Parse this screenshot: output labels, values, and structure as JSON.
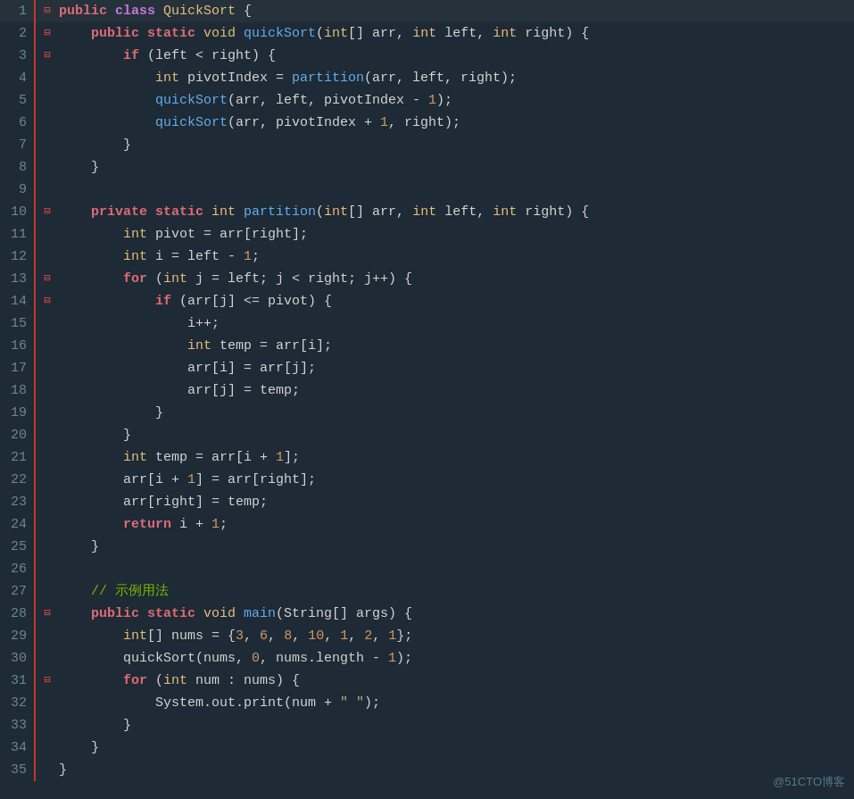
{
  "lines": [
    {
      "num": 1,
      "fold": "⊟",
      "tokens": [
        {
          "t": "public ",
          "c": "kw"
        },
        {
          "t": "class ",
          "c": "kw2"
        },
        {
          "t": "QuickSort",
          "c": "cls"
        },
        {
          "t": " {",
          "c": "punct"
        }
      ]
    },
    {
      "num": 2,
      "fold": "⊟",
      "tokens": [
        {
          "t": "    public ",
          "c": "kw"
        },
        {
          "t": "static ",
          "c": "kw"
        },
        {
          "t": "void ",
          "c": "type"
        },
        {
          "t": "quickSort",
          "c": "fn"
        },
        {
          "t": "(",
          "c": "punct"
        },
        {
          "t": "int",
          "c": "type"
        },
        {
          "t": "[] arr, ",
          "c": "var"
        },
        {
          "t": "int ",
          "c": "type"
        },
        {
          "t": "left, ",
          "c": "var"
        },
        {
          "t": "int ",
          "c": "type"
        },
        {
          "t": "right) {",
          "c": "var"
        }
      ]
    },
    {
      "num": 3,
      "fold": "⊟",
      "tokens": [
        {
          "t": "        ",
          "c": ""
        },
        {
          "t": "if ",
          "c": "kw"
        },
        {
          "t": "(left < right) {",
          "c": "var"
        }
      ]
    },
    {
      "num": 4,
      "fold": "",
      "tokens": [
        {
          "t": "            ",
          "c": ""
        },
        {
          "t": "int ",
          "c": "type"
        },
        {
          "t": "pivotIndex = ",
          "c": "var"
        },
        {
          "t": "partition",
          "c": "fn"
        },
        {
          "t": "(arr, left, right);",
          "c": "var"
        }
      ]
    },
    {
      "num": 5,
      "fold": "",
      "tokens": [
        {
          "t": "            ",
          "c": ""
        },
        {
          "t": "quickSort",
          "c": "fn"
        },
        {
          "t": "(arr, left, pivotIndex - ",
          "c": "var"
        },
        {
          "t": "1",
          "c": "num"
        },
        {
          "t": ");",
          "c": "punct"
        }
      ]
    },
    {
      "num": 6,
      "fold": "",
      "tokens": [
        {
          "t": "            ",
          "c": ""
        },
        {
          "t": "quickSort",
          "c": "fn"
        },
        {
          "t": "(arr, pivotIndex + ",
          "c": "var"
        },
        {
          "t": "1",
          "c": "num"
        },
        {
          "t": ", right);",
          "c": "punct"
        }
      ]
    },
    {
      "num": 7,
      "fold": "",
      "tokens": [
        {
          "t": "        }",
          "c": "punct"
        }
      ]
    },
    {
      "num": 8,
      "fold": "",
      "tokens": [
        {
          "t": "    }",
          "c": "punct"
        }
      ]
    },
    {
      "num": 9,
      "fold": "",
      "tokens": [
        {
          "t": "",
          "c": ""
        }
      ]
    },
    {
      "num": 10,
      "fold": "⊟",
      "tokens": [
        {
          "t": "    ",
          "c": ""
        },
        {
          "t": "private ",
          "c": "kw"
        },
        {
          "t": "static ",
          "c": "kw"
        },
        {
          "t": "int ",
          "c": "type"
        },
        {
          "t": "partition",
          "c": "fn"
        },
        {
          "t": "(",
          "c": "punct"
        },
        {
          "t": "int",
          "c": "type"
        },
        {
          "t": "[] arr, ",
          "c": "var"
        },
        {
          "t": "int ",
          "c": "type"
        },
        {
          "t": "left, ",
          "c": "var"
        },
        {
          "t": "int ",
          "c": "type"
        },
        {
          "t": "right) {",
          "c": "var"
        }
      ]
    },
    {
      "num": 11,
      "fold": "",
      "tokens": [
        {
          "t": "        ",
          "c": ""
        },
        {
          "t": "int ",
          "c": "type"
        },
        {
          "t": "pivot = arr[right];",
          "c": "var"
        }
      ]
    },
    {
      "num": 12,
      "fold": "",
      "tokens": [
        {
          "t": "        ",
          "c": ""
        },
        {
          "t": "int ",
          "c": "type"
        },
        {
          "t": "i = left - ",
          "c": "var"
        },
        {
          "t": "1",
          "c": "num"
        },
        {
          "t": ";",
          "c": "punct"
        }
      ]
    },
    {
      "num": 13,
      "fold": "⊟",
      "tokens": [
        {
          "t": "        ",
          "c": ""
        },
        {
          "t": "for ",
          "c": "kw"
        },
        {
          "t": "(",
          "c": "punct"
        },
        {
          "t": "int ",
          "c": "type"
        },
        {
          "t": "j = left; j < right; j++) {",
          "c": "var"
        }
      ]
    },
    {
      "num": 14,
      "fold": "⊟",
      "tokens": [
        {
          "t": "            ",
          "c": ""
        },
        {
          "t": "if ",
          "c": "kw"
        },
        {
          "t": "(arr[j] <= pivot) {",
          "c": "var"
        }
      ]
    },
    {
      "num": 15,
      "fold": "",
      "tokens": [
        {
          "t": "                ",
          "c": ""
        },
        {
          "t": "i++;",
          "c": "var"
        }
      ]
    },
    {
      "num": 16,
      "fold": "",
      "tokens": [
        {
          "t": "                ",
          "c": ""
        },
        {
          "t": "int ",
          "c": "type"
        },
        {
          "t": "temp = arr[i];",
          "c": "var"
        }
      ]
    },
    {
      "num": 17,
      "fold": "",
      "tokens": [
        {
          "t": "                ",
          "c": ""
        },
        {
          "t": "arr[i] = arr[j];",
          "c": "var"
        }
      ]
    },
    {
      "num": 18,
      "fold": "",
      "tokens": [
        {
          "t": "                ",
          "c": ""
        },
        {
          "t": "arr[j] = temp;",
          "c": "var"
        }
      ]
    },
    {
      "num": 19,
      "fold": "",
      "tokens": [
        {
          "t": "            }",
          "c": "punct"
        }
      ]
    },
    {
      "num": 20,
      "fold": "",
      "tokens": [
        {
          "t": "        }",
          "c": "punct"
        }
      ]
    },
    {
      "num": 21,
      "fold": "",
      "tokens": [
        {
          "t": "        ",
          "c": ""
        },
        {
          "t": "int ",
          "c": "type"
        },
        {
          "t": "temp = arr[i + ",
          "c": "var"
        },
        {
          "t": "1",
          "c": "num"
        },
        {
          "t": "];",
          "c": "punct"
        }
      ]
    },
    {
      "num": 22,
      "fold": "",
      "tokens": [
        {
          "t": "        arr[i + ",
          "c": "var"
        },
        {
          "t": "1",
          "c": "num"
        },
        {
          "t": "] = arr[right];",
          "c": "punct"
        }
      ]
    },
    {
      "num": 23,
      "fold": "",
      "tokens": [
        {
          "t": "        arr[right] = temp;",
          "c": "var"
        }
      ]
    },
    {
      "num": 24,
      "fold": "",
      "tokens": [
        {
          "t": "        ",
          "c": ""
        },
        {
          "t": "return ",
          "c": "kw"
        },
        {
          "t": "i + ",
          "c": "var"
        },
        {
          "t": "1",
          "c": "num"
        },
        {
          "t": ";",
          "c": "punct"
        }
      ]
    },
    {
      "num": 25,
      "fold": "",
      "tokens": [
        {
          "t": "    }",
          "c": "punct"
        }
      ]
    },
    {
      "num": 26,
      "fold": "",
      "tokens": [
        {
          "t": "",
          "c": ""
        }
      ]
    },
    {
      "num": 27,
      "fold": "",
      "tokens": [
        {
          "t": "    ",
          "c": ""
        },
        {
          "t": "// 示例用法",
          "c": "comment"
        }
      ]
    },
    {
      "num": 28,
      "fold": "⊟",
      "tokens": [
        {
          "t": "    ",
          "c": ""
        },
        {
          "t": "public ",
          "c": "kw"
        },
        {
          "t": "static ",
          "c": "kw"
        },
        {
          "t": "void ",
          "c": "type"
        },
        {
          "t": "main",
          "c": "fn"
        },
        {
          "t": "(String[] args) {",
          "c": "var"
        }
      ]
    },
    {
      "num": 29,
      "fold": "",
      "tokens": [
        {
          "t": "        ",
          "c": ""
        },
        {
          "t": "int",
          "c": "type"
        },
        {
          "t": "[] nums = {",
          "c": "var"
        },
        {
          "t": "3",
          "c": "num"
        },
        {
          "t": ", ",
          "c": "punct"
        },
        {
          "t": "6",
          "c": "num"
        },
        {
          "t": ", ",
          "c": "punct"
        },
        {
          "t": "8",
          "c": "num"
        },
        {
          "t": ", ",
          "c": "punct"
        },
        {
          "t": "10",
          "c": "num"
        },
        {
          "t": ", ",
          "c": "punct"
        },
        {
          "t": "1",
          "c": "num"
        },
        {
          "t": ", ",
          "c": "punct"
        },
        {
          "t": "2",
          "c": "num"
        },
        {
          "t": ", ",
          "c": "punct"
        },
        {
          "t": "1",
          "c": "num"
        },
        {
          "t": "};",
          "c": "punct"
        }
      ]
    },
    {
      "num": 30,
      "fold": "",
      "tokens": [
        {
          "t": "        quickSort(nums, ",
          "c": "var"
        },
        {
          "t": "0",
          "c": "num"
        },
        {
          "t": ", nums.length - ",
          "c": "var"
        },
        {
          "t": "1",
          "c": "num"
        },
        {
          "t": ");",
          "c": "punct"
        }
      ]
    },
    {
      "num": 31,
      "fold": "⊟",
      "tokens": [
        {
          "t": "        ",
          "c": ""
        },
        {
          "t": "for ",
          "c": "kw"
        },
        {
          "t": "(",
          "c": "punct"
        },
        {
          "t": "int ",
          "c": "type"
        },
        {
          "t": "num : nums) {",
          "c": "var"
        }
      ]
    },
    {
      "num": 32,
      "fold": "",
      "tokens": [
        {
          "t": "            System.out.print(num + ",
          "c": "var"
        },
        {
          "t": "\" \"",
          "c": "str"
        },
        {
          "t": ");",
          "c": "punct"
        }
      ]
    },
    {
      "num": 33,
      "fold": "",
      "tokens": [
        {
          "t": "        }",
          "c": "punct"
        }
      ]
    },
    {
      "num": 34,
      "fold": "",
      "tokens": [
        {
          "t": "    }",
          "c": "punct"
        }
      ]
    },
    {
      "num": 35,
      "fold": "",
      "tokens": [
        {
          "t": "}",
          "c": "punct"
        }
      ]
    }
  ],
  "watermark": "@51CTO博客"
}
